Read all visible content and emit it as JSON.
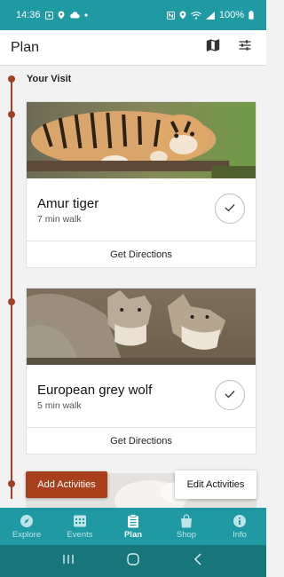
{
  "status_bar": {
    "time": "14:36",
    "battery": "100%",
    "icons_left": [
      "media-icon",
      "location-icon",
      "cloud-icon",
      "dot-icon"
    ],
    "icons_right": [
      "nfc-icon",
      "location-icon",
      "wifi-icon",
      "signal-icon",
      "battery-icon"
    ]
  },
  "app_bar": {
    "title": "Plan",
    "actions": [
      "map-icon",
      "filter-sliders-icon"
    ]
  },
  "section": {
    "title": "Your Visit"
  },
  "visit_items": [
    {
      "name": "Amur tiger",
      "walk": "7 min walk",
      "action": "Get Directions",
      "checked": true,
      "photo": "tiger"
    },
    {
      "name": "European grey wolf",
      "walk": "5 min walk",
      "action": "Get Directions",
      "checked": true,
      "photo": "wolf"
    }
  ],
  "buttons": {
    "add": "Add Activities",
    "edit": "Edit Activities"
  },
  "bottom_nav": {
    "items": [
      {
        "label": "Explore",
        "icon": "compass-icon",
        "active": false
      },
      {
        "label": "Events",
        "icon": "calendar-icon",
        "active": false
      },
      {
        "label": "Plan",
        "icon": "clipboard-icon",
        "active": true
      },
      {
        "label": "Shop",
        "icon": "shopping-bag-icon",
        "active": false
      },
      {
        "label": "Info",
        "icon": "info-icon",
        "active": false
      }
    ]
  },
  "system_nav": [
    "recents-icon",
    "home-icon",
    "back-icon"
  ],
  "colors": {
    "primary": "#1f9aa3",
    "primary_dark": "#17757c",
    "accent": "#a8401d",
    "timeline": "#a44024"
  }
}
